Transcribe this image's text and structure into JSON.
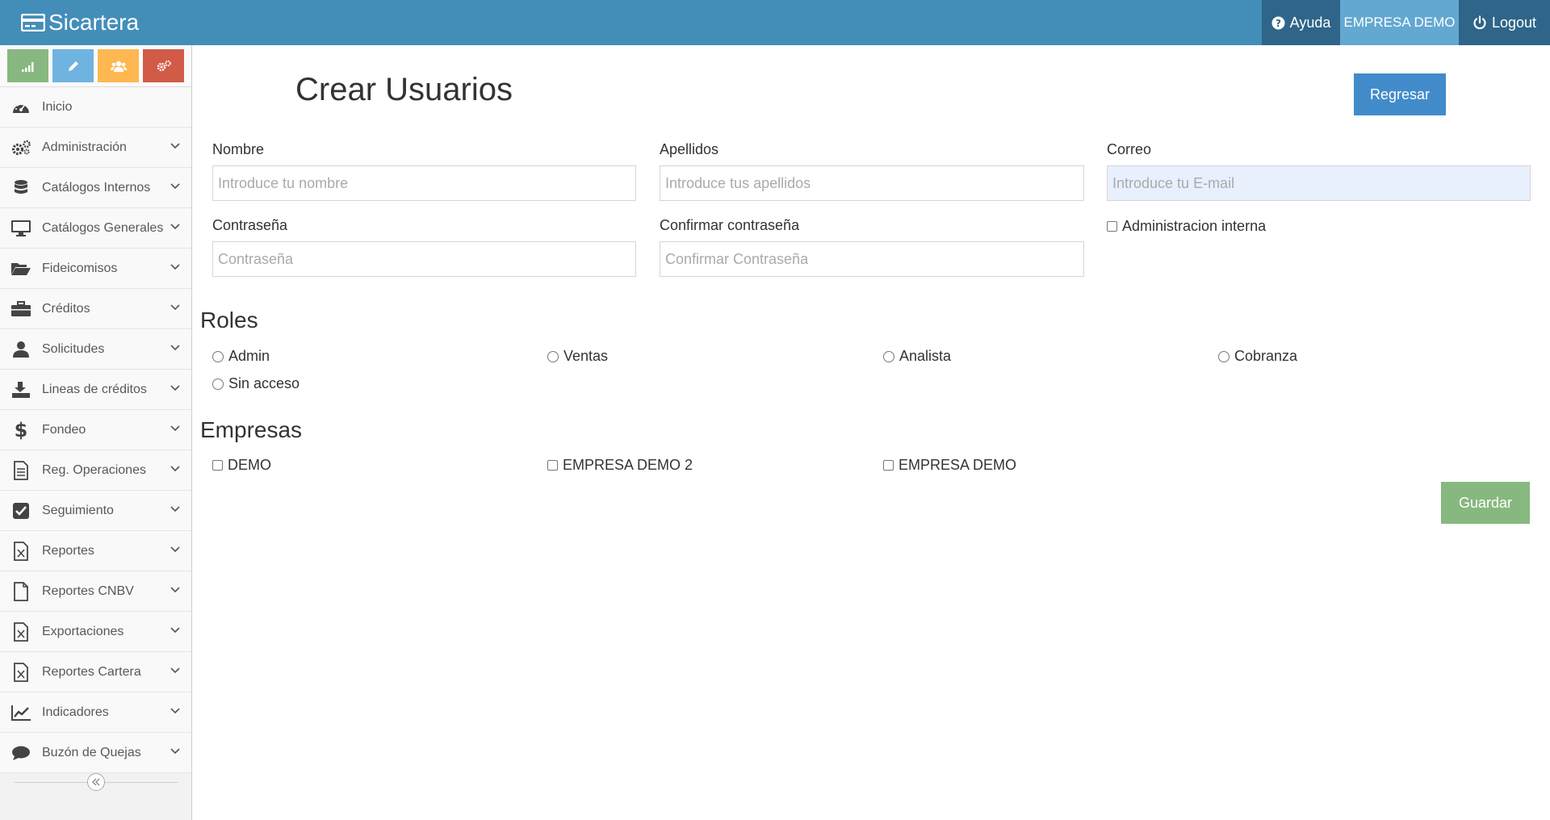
{
  "navbar": {
    "brand": "Sicartera",
    "help_label": "Ayuda",
    "company_label": "EMPRESA DEMO",
    "logout_label": "Logout"
  },
  "sidebar": {
    "shortcuts": [
      {
        "icon": "signal-icon",
        "color": "#87b87f"
      },
      {
        "icon": "pencil-icon",
        "color": "#6fb3e0"
      },
      {
        "icon": "users-icon",
        "color": "#ffb752"
      },
      {
        "icon": "cogs-icon",
        "color": "#d15b47"
      }
    ],
    "items": [
      {
        "label": "Inicio",
        "icon": "dashboard-icon"
      },
      {
        "label": "Administración",
        "icon": "cogs-icon"
      },
      {
        "label": "Catálogos Internos",
        "icon": "database-icon"
      },
      {
        "label": "Catálogos Generales",
        "icon": "desktop-icon"
      },
      {
        "label": "Fideicomisos",
        "icon": "folder-open-icon"
      },
      {
        "label": "Créditos",
        "icon": "briefcase-icon"
      },
      {
        "label": "Solicitudes",
        "icon": "user-icon"
      },
      {
        "label": "Lineas de créditos",
        "icon": "download-icon"
      },
      {
        "label": "Fondeo",
        "icon": "dollar-icon"
      },
      {
        "label": "Reg. Operaciones",
        "icon": "document-icon"
      },
      {
        "label": "Seguimiento",
        "icon": "check-square-icon"
      },
      {
        "label": "Reportes",
        "icon": "excel-file-icon"
      },
      {
        "label": "Reportes CNBV",
        "icon": "file-icon"
      },
      {
        "label": "Exportaciones",
        "icon": "excel-file-icon"
      },
      {
        "label": "Reportes Cartera",
        "icon": "excel-file-icon"
      },
      {
        "label": "Indicadores",
        "icon": "line-chart-icon"
      },
      {
        "label": "Buzón de Quejas",
        "icon": "comment-icon"
      }
    ]
  },
  "main": {
    "title": "Crear Usuarios",
    "back_button": "Regresar",
    "save_button": "Guardar",
    "fields": {
      "nombre": {
        "label": "Nombre",
        "placeholder": "Introduce tu nombre",
        "value": ""
      },
      "apellidos": {
        "label": "Apellidos",
        "placeholder": "Introduce tus apellidos",
        "value": ""
      },
      "correo": {
        "label": "Correo",
        "placeholder": "Introduce tu E-mail",
        "value": ""
      },
      "contrasena": {
        "label": "Contraseña",
        "placeholder": "Contraseña",
        "value": ""
      },
      "confirmar": {
        "label": "Confirmar contraseña",
        "placeholder": "Confirmar Contraseña",
        "value": ""
      }
    },
    "admin_interna_label": "Administracion interna",
    "roles_title": "Roles",
    "roles": [
      "Admin",
      "Ventas",
      "Analista",
      "Cobranza",
      "Sin acceso"
    ],
    "empresas_title": "Empresas",
    "empresas": [
      "DEMO",
      "EMPRESA DEMO 2",
      "EMPRESA DEMO"
    ]
  }
}
